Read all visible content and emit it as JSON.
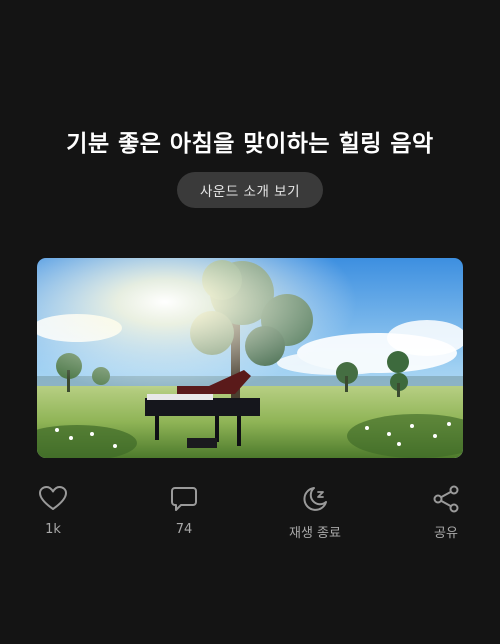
{
  "content": {
    "title": "기분 좋은 아침을 맞이하는 힐링 음악",
    "intro_button_label": "사운드 소개 보기",
    "image_description": "Grand piano in a sunny meadow with trees"
  },
  "actions": [
    {
      "id": "like",
      "icon": "heart-icon",
      "label": "1k"
    },
    {
      "id": "comment",
      "icon": "comment-icon",
      "label": "74"
    },
    {
      "id": "sleep-timer",
      "icon": "moon-zz-icon",
      "label": "재생 종료"
    },
    {
      "id": "share",
      "icon": "share-icon",
      "label": "공유"
    }
  ],
  "colors": {
    "background": "#141414",
    "button_bg": "#3a3a3a",
    "icon": "#9a9a9a",
    "label": "#a8a8a8"
  }
}
